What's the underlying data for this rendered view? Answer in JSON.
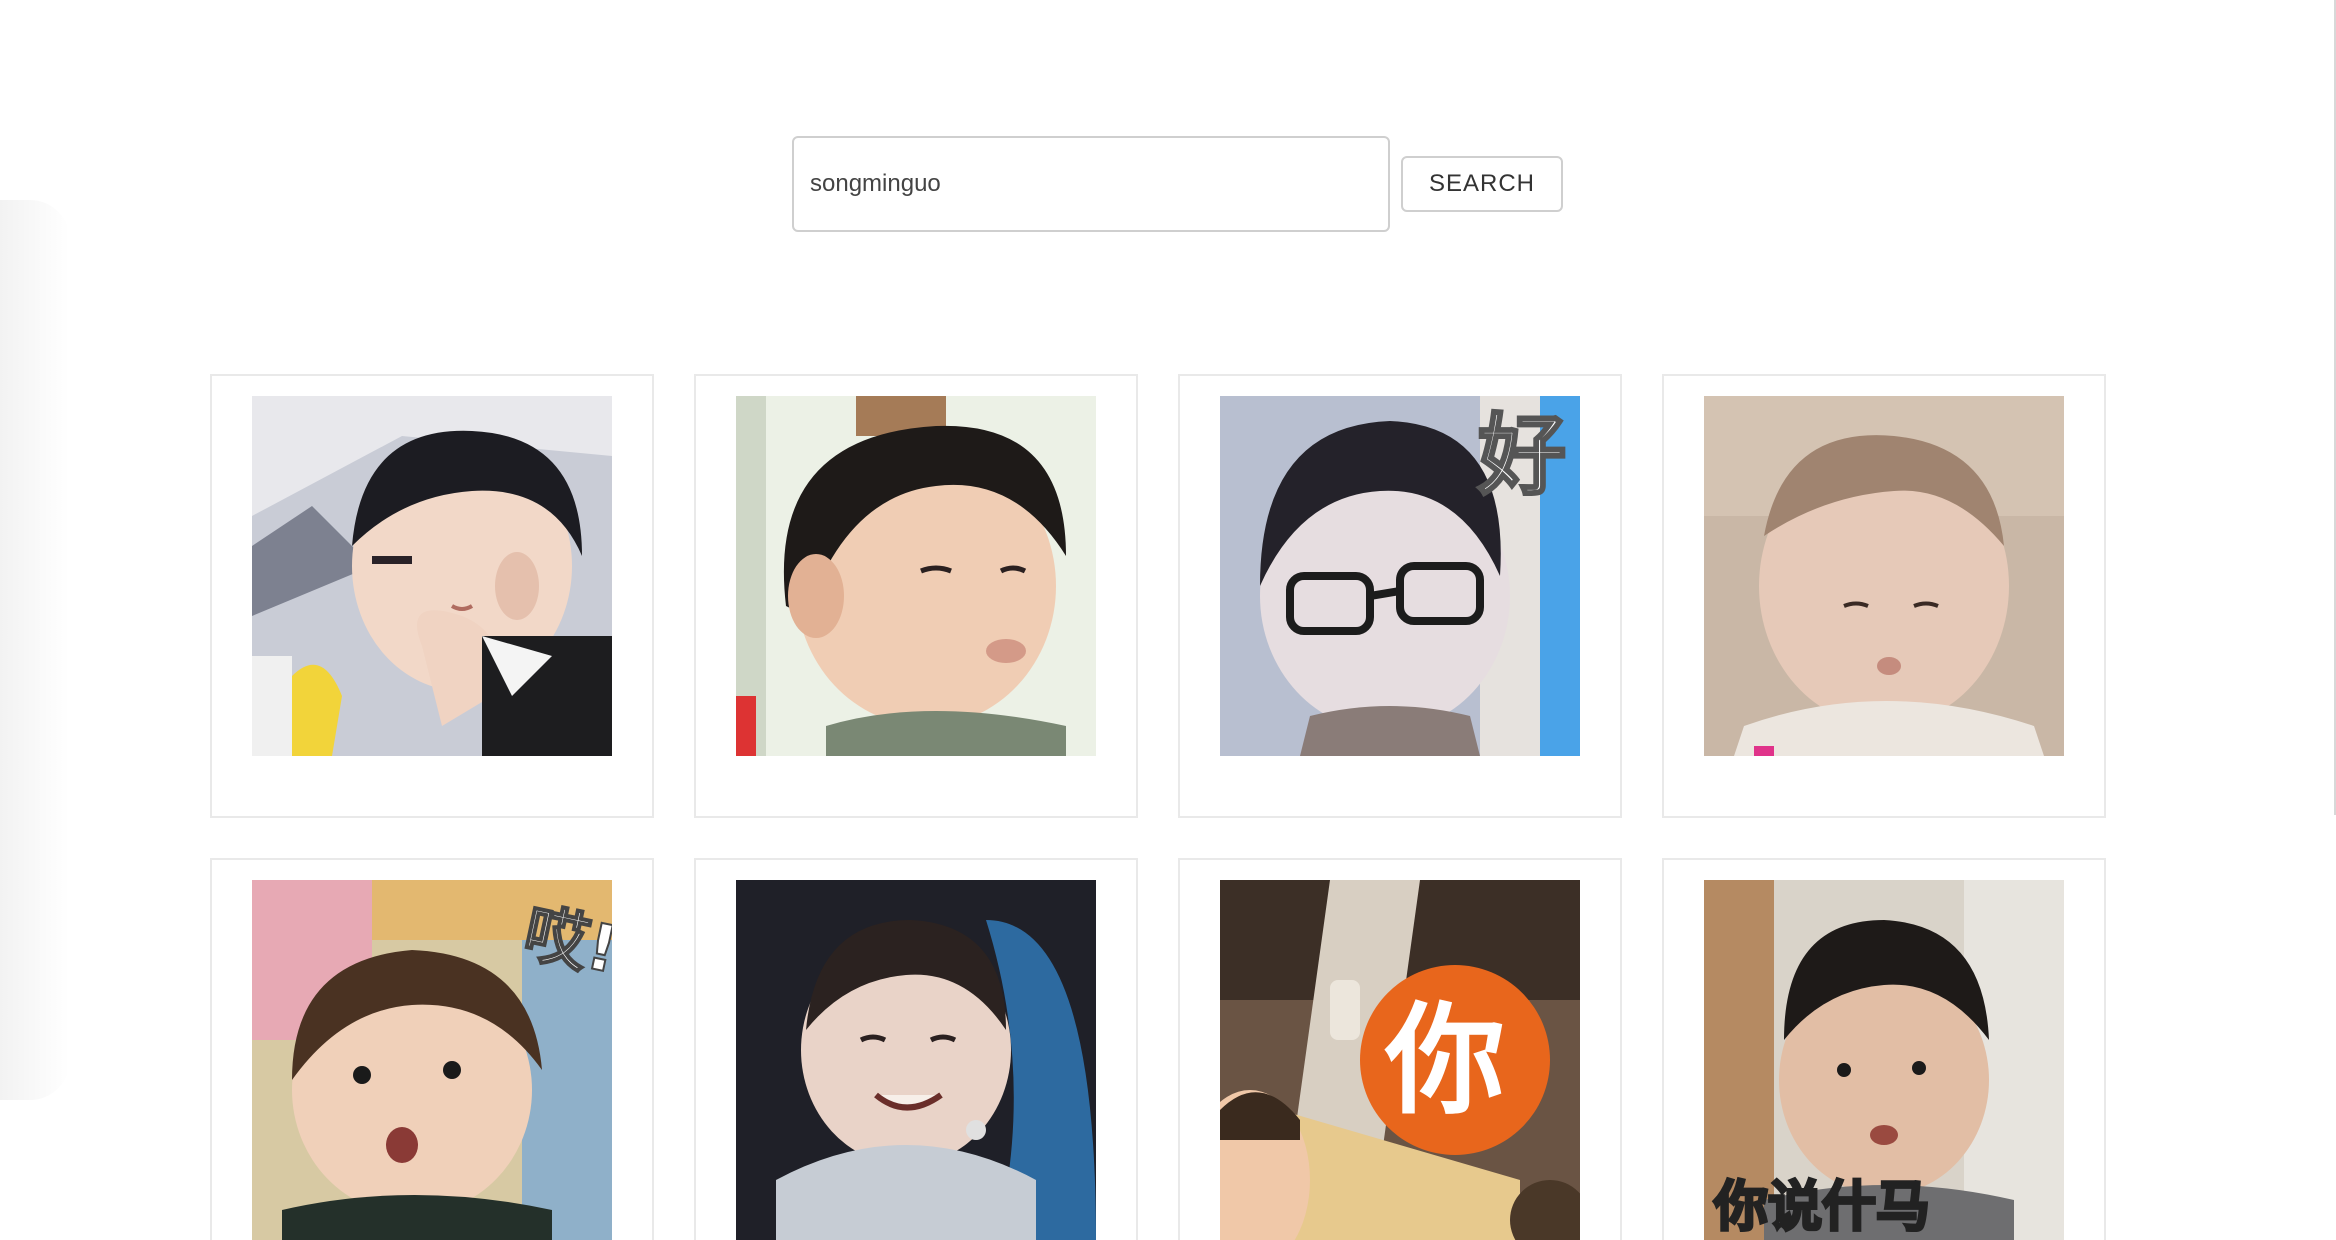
{
  "search": {
    "value": "songminguo",
    "button_label": "SEARCH"
  },
  "results": [
    {
      "icon": "toddler-resting-chin-image",
      "caption": ""
    },
    {
      "icon": "toddler-smiling-image",
      "caption": ""
    },
    {
      "icon": "toddler-glasses-image",
      "caption": "好"
    },
    {
      "icon": "baby-pouting-image",
      "caption": ""
    },
    {
      "icon": "toddler-surprised-image",
      "caption": "哎!!"
    },
    {
      "icon": "toddler-laughing-image",
      "caption": ""
    },
    {
      "icon": "child-peeking-image",
      "caption": "你"
    },
    {
      "icon": "toddler-talking-image",
      "caption": "你说什马"
    }
  ]
}
